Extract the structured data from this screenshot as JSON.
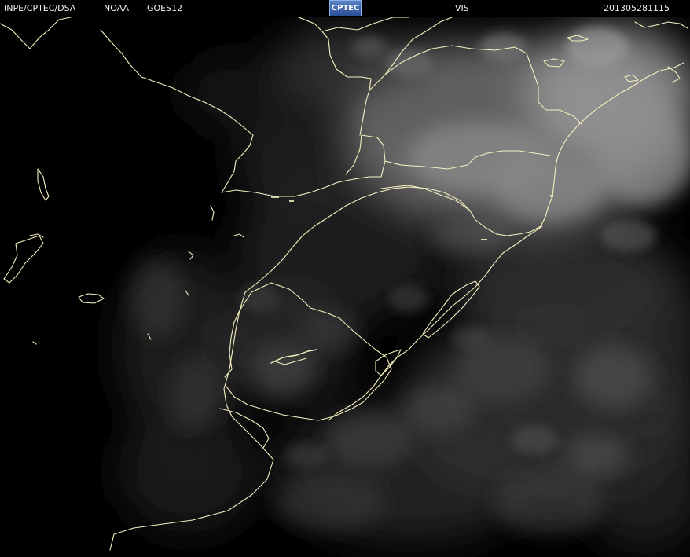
{
  "header": {
    "source_label": "INPE/CPTEC/DSA",
    "agency_label": "NOAA",
    "satellite_label": "GOES12",
    "logo_text": "CPTEC",
    "channel_label": "VIS",
    "timestamp": "201305281115"
  },
  "colors": {
    "background": "#000000",
    "borders": "#f4f0c0",
    "text": "#f2f2f2",
    "logo_blue": "#3c66b0"
  }
}
